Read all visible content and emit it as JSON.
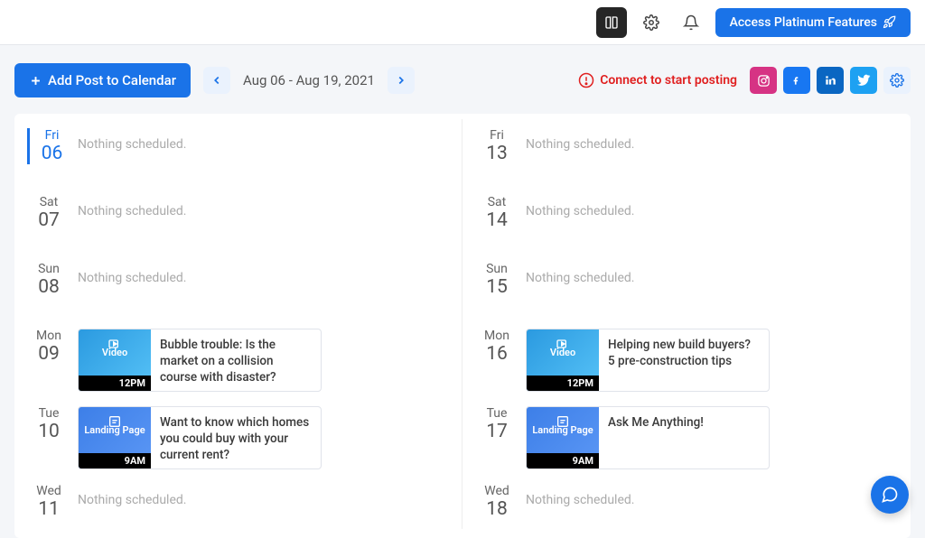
{
  "header": {
    "access_platinum": "Access Platinum Features"
  },
  "toolbar": {
    "add_post_label": "Add Post to Calendar",
    "date_range": "Aug 06 - Aug 19, 2021",
    "warning_text": "Connect to start posting"
  },
  "columns": [
    {
      "days": [
        {
          "name": "Fri",
          "num": "06",
          "active": true,
          "empty_text": "Nothing scheduled.",
          "posts": []
        },
        {
          "name": "Sat",
          "num": "07",
          "empty_text": "Nothing scheduled.",
          "posts": []
        },
        {
          "name": "Sun",
          "num": "08",
          "empty_text": "Nothing scheduled.",
          "posts": []
        },
        {
          "name": "Mon",
          "num": "09",
          "posts": [
            {
              "type": "video",
              "type_label": "Video",
              "time": "12PM",
              "title": "Bubble trouble: Is the market on a collision course with disaster?"
            }
          ]
        },
        {
          "name": "Tue",
          "num": "10",
          "posts": [
            {
              "type": "landing",
              "type_label": "Landing Page",
              "time": "9AM",
              "title": "Want to know which homes you could buy with your current rent?"
            }
          ]
        },
        {
          "name": "Wed",
          "num": "11",
          "empty_text": "Nothing scheduled.",
          "posts": []
        }
      ]
    },
    {
      "days": [
        {
          "name": "Fri",
          "num": "13",
          "empty_text": "Nothing scheduled.",
          "posts": []
        },
        {
          "name": "Sat",
          "num": "14",
          "empty_text": "Nothing scheduled.",
          "posts": []
        },
        {
          "name": "Sun",
          "num": "15",
          "empty_text": "Nothing scheduled.",
          "posts": []
        },
        {
          "name": "Mon",
          "num": "16",
          "posts": [
            {
              "type": "video",
              "type_label": "Video",
              "time": "12PM",
              "title": "Helping new build buyers? 5 pre-construction tips"
            }
          ]
        },
        {
          "name": "Tue",
          "num": "17",
          "posts": [
            {
              "type": "landing",
              "type_label": "Landing Page",
              "time": "9AM",
              "title": "Ask Me Anything!"
            }
          ]
        },
        {
          "name": "Wed",
          "num": "18",
          "empty_text": "Nothing scheduled.",
          "posts": []
        }
      ]
    }
  ]
}
